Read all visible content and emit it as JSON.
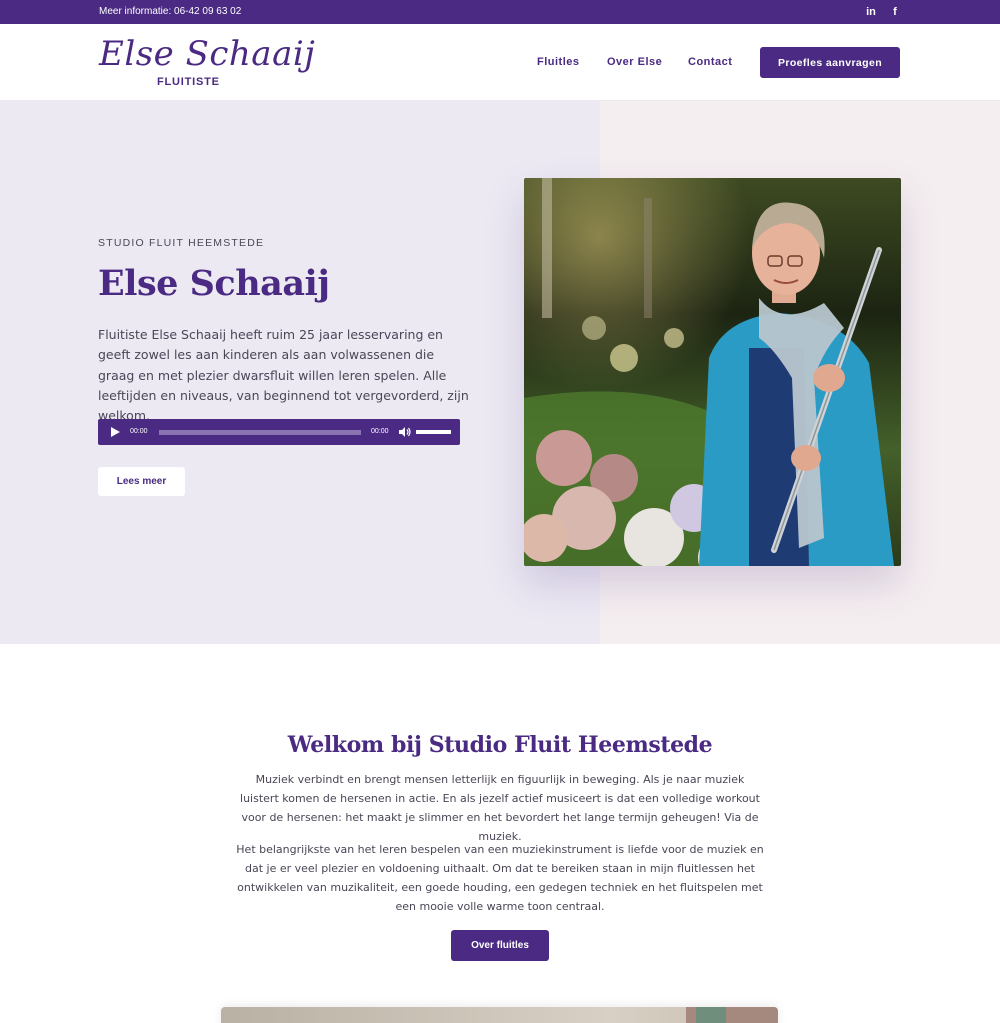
{
  "topbar": {
    "info": "Meer informatie: 06-42 09 63 02",
    "social": [
      {
        "icon": "linkedin-icon",
        "glyph": "in"
      },
      {
        "icon": "facebook-icon",
        "glyph": "f"
      }
    ]
  },
  "header": {
    "logo_script": "Else Schaaij",
    "logo_sub": "FLUITISTE",
    "nav": [
      "Fluitles",
      "Over Else",
      "Contact"
    ],
    "cta": "Proefles aanvragen"
  },
  "hero": {
    "eyebrow": "STUDIO FLUIT HEEMSTEDE",
    "title": "Else Schaaij",
    "text": "Fluitiste Else Schaaij heeft ruim 25 jaar lesservaring en geeft zowel les aan kinderen als aan volwassenen die graag en met plezier dwarsfluit willen leren spelen. Alle leeftijden en niveaus, van beginnend tot vergevorderd, zijn welkom.",
    "audio": {
      "current": "00:00",
      "duration": "00:00",
      "volume": 1.0
    },
    "read_more": "Lees meer"
  },
  "welcome": {
    "title": "Welkom bij Studio Fluit Heemstede",
    "paragraph1": "Muziek verbindt en brengt mensen letterlijk en figuurlijk in beweging. Als je naar muziek luistert komen de hersenen in actie. En als jezelf actief musiceert is dat een volledige workout voor de hersenen: het maakt je slimmer en het bevordert het lange termijn geheugen! Via de muziek.",
    "paragraph2": "Het belangrijkste van het leren bespelen van een muziekinstrument is liefde voor de muziek en dat je er veel plezier en voldoening uithaalt. Om dat te bereiken staan in mijn fluitlessen het ontwikkelen van muzikaliteit, een goede houding, een gedegen techniek en het fluitspelen met een mooie volle warme toon centraal.",
    "button": "Over fluitles"
  },
  "colors": {
    "brand": "#4a2a82",
    "hero_left": "#ece9f3",
    "hero_right": "#f5eef0",
    "text": "#4b4556"
  }
}
